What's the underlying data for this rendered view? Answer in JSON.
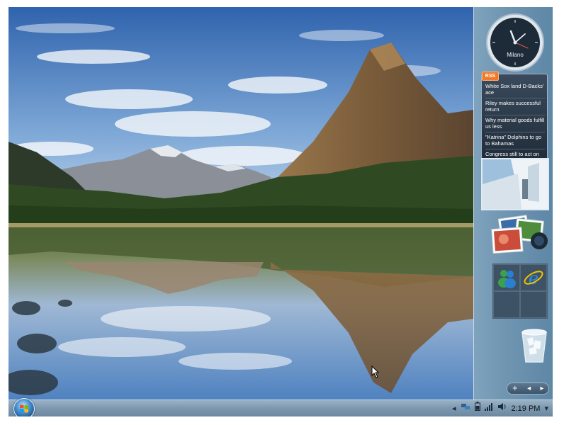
{
  "sidebar": {
    "clock": {
      "city": "Milano"
    },
    "rss": {
      "badge": "RSS",
      "headlines": [
        "White Sox land D-Backs' ace",
        "Riley makes successful return",
        "Why material goods fulfill us less",
        "\"Katrina\" Dolphins to go to Bahamas",
        "Congress still to act on key measures"
      ]
    },
    "controls": {
      "add": "+",
      "prev": "◂",
      "next": "▸"
    }
  },
  "taskbar": {
    "time": "2:19 PM",
    "tray_icons": [
      "chevron-left-icon",
      "network-icon",
      "battery-icon",
      "signal-icon",
      "volume-icon",
      "chevron-down-icon"
    ]
  },
  "colors": {
    "sky": "#3d6fb0",
    "rss_badge": "#f07a2a",
    "sidebar": "#6f95b1",
    "taskbar": "#7d99b0"
  }
}
